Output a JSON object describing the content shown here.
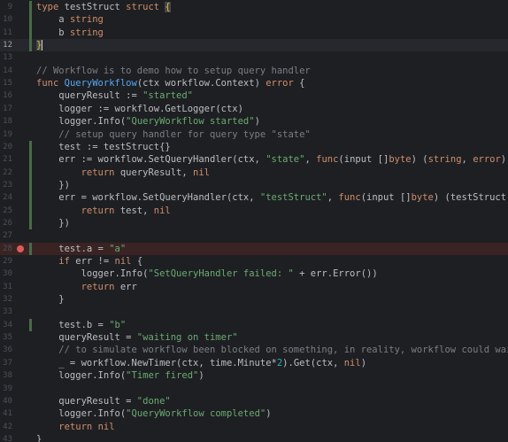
{
  "editor": {
    "lines": [
      {
        "n": "9",
        "text": "type testStruct struct {"
      },
      {
        "n": "10",
        "text": "    a string"
      },
      {
        "n": "11",
        "text": "    b string"
      },
      {
        "n": "12",
        "text": "}"
      },
      {
        "n": "13",
        "text": ""
      },
      {
        "n": "14",
        "text": "// Workflow is to demo how to setup query handler"
      },
      {
        "n": "15",
        "text": "func QueryWorkflow(ctx workflow.Context) error {"
      },
      {
        "n": "16",
        "text": "    queryResult := \"started\""
      },
      {
        "n": "17",
        "text": "    logger := workflow.GetLogger(ctx)"
      },
      {
        "n": "18",
        "text": "    logger.Info(\"QueryWorkflow started\")"
      },
      {
        "n": "19",
        "text": "    // setup query handler for query type \"state\""
      },
      {
        "n": "20",
        "text": "    test := testStruct{}"
      },
      {
        "n": "21",
        "text": "    err := workflow.SetQueryHandler(ctx, \"state\", func(input []byte) (string, error) {"
      },
      {
        "n": "22",
        "text": "        return queryResult, nil"
      },
      {
        "n": "23",
        "text": "    })"
      },
      {
        "n": "24",
        "text": "    err = workflow.SetQueryHandler(ctx, \"testStruct\", func(input []byte) (testStruct, error) {"
      },
      {
        "n": "25",
        "text": "        return test, nil"
      },
      {
        "n": "26",
        "text": "    })"
      },
      {
        "n": "27",
        "text": ""
      },
      {
        "n": "28",
        "text": "    test.a = \"a\""
      },
      {
        "n": "29",
        "text": "    if err != nil {"
      },
      {
        "n": "30",
        "text": "        logger.Info(\"SetQueryHandler failed: \" + err.Error())"
      },
      {
        "n": "31",
        "text": "        return err"
      },
      {
        "n": "32",
        "text": "    }"
      },
      {
        "n": "33",
        "text": ""
      },
      {
        "n": "34",
        "text": "    test.b = \"b\""
      },
      {
        "n": "35",
        "text": "    queryResult = \"waiting on timer\""
      },
      {
        "n": "36",
        "text": "    // to simulate workflow been blocked on something, in reality, workflow could wait on anything like"
      },
      {
        "n": "37",
        "text": "    _ = workflow.NewTimer(ctx, time.Minute*2).Get(ctx, nil)"
      },
      {
        "n": "38",
        "text": "    logger.Info(\"Timer fired\")"
      },
      {
        "n": "39",
        "text": ""
      },
      {
        "n": "40",
        "text": "    queryResult = \"done\""
      },
      {
        "n": "41",
        "text": "    logger.Info(\"QueryWorkflow completed\")"
      },
      {
        "n": "42",
        "text": "    return nil"
      },
      {
        "n": "43",
        "text": "}"
      }
    ],
    "current_line": "12",
    "breakpoint_line": "28",
    "colors": {
      "background": "#1e1f22",
      "keyword": "#cf8e6d",
      "function": "#56a8f5",
      "string": "#6aab73",
      "comment": "#7a7e85",
      "number": "#2aacb8",
      "breakpoint": "#db5c5c"
    }
  }
}
